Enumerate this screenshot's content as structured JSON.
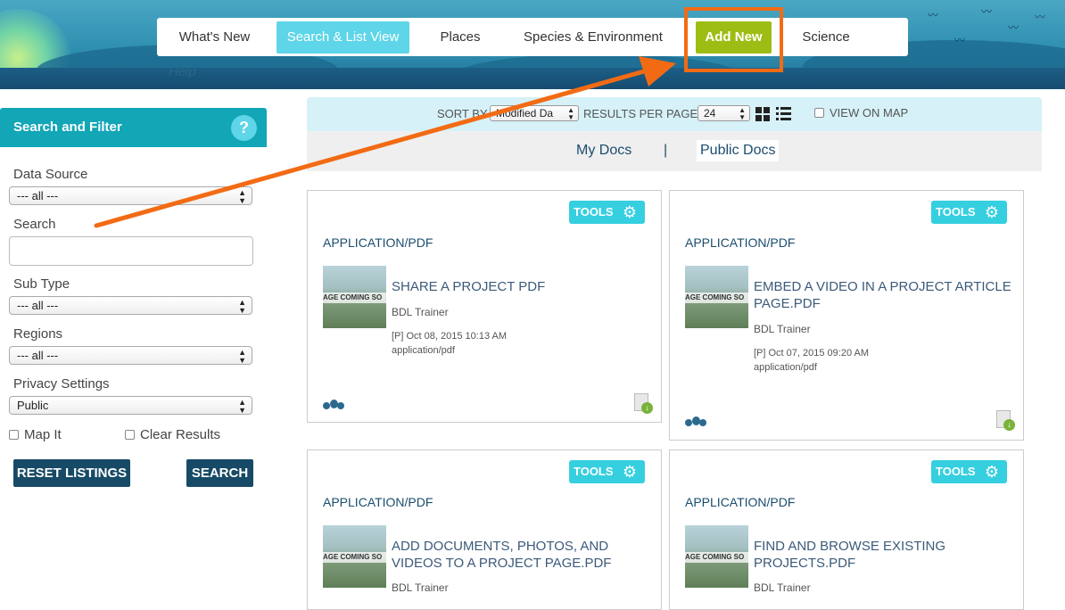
{
  "colors": {
    "accent": "#5ed5e8",
    "add_new": "#9dbd14",
    "highlight": "#f26b14",
    "sidebar_header": "#12a6b7",
    "button_dark": "#174a66",
    "tools": "#35cfe0"
  },
  "nav": {
    "items": [
      "What's New",
      "Search & List View",
      "Places",
      "Species & Environment",
      "Add New",
      "Science"
    ],
    "active": "Search & List View",
    "help": "Help"
  },
  "sidebar": {
    "title": "Search and Filter",
    "help_icon": "question-icon",
    "help_symbol": "?",
    "data_source_label": "Data Source",
    "data_source_value": "--- all ---",
    "search_label": "Search",
    "search_value": "",
    "sub_type_label": "Sub Type",
    "sub_type_value": "--- all ---",
    "regions_label": "Regions",
    "regions_value": "--- all ---",
    "privacy_label": "Privacy Settings",
    "privacy_value": "Public",
    "map_it_label": "Map It",
    "clear_results_label": "Clear Results",
    "reset_button": "RESET LISTINGS",
    "search_button": "SEARCH"
  },
  "toolbar": {
    "sort_by_label": "SORT BY",
    "sort_by_value": "Modified Da",
    "results_per_page_label": "RESULTS PER PAGE",
    "results_per_page_value": "24",
    "view_on_map_label": "VIEW ON MAP"
  },
  "tabs": {
    "my_docs": "My Docs",
    "separator": "|",
    "public_docs": "Public Docs",
    "active": "Public Docs"
  },
  "cards": [
    {
      "tools": "TOOLS",
      "type": "APPLICATION/PDF",
      "thumb_text": "AGE COMING SO",
      "title": "SHARE A PROJECT PDF",
      "author": "BDL Trainer",
      "date": "[P] Oct 08, 2015 10:13 AM",
      "mime": "application/pdf"
    },
    {
      "tools": "TOOLS",
      "type": "APPLICATION/PDF",
      "thumb_text": "AGE COMING SO",
      "title": "EMBED A VIDEO IN A PROJECT ARTICLE PAGE.PDF",
      "author": "BDL Trainer",
      "date": "[P] Oct 07, 2015 09:20 AM",
      "mime": "application/pdf"
    },
    {
      "tools": "TOOLS",
      "type": "APPLICATION/PDF",
      "thumb_text": "AGE COMING SO",
      "title": "ADD DOCUMENTS, PHOTOS, AND VIDEOS TO A PROJECT PAGE.PDF",
      "author": "BDL Trainer"
    },
    {
      "tools": "TOOLS",
      "type": "APPLICATION/PDF",
      "thumb_text": "AGE COMING SO",
      "title": "FIND AND BROWSE EXISTING PROJECTS.PDF",
      "author": "BDL Trainer"
    }
  ]
}
